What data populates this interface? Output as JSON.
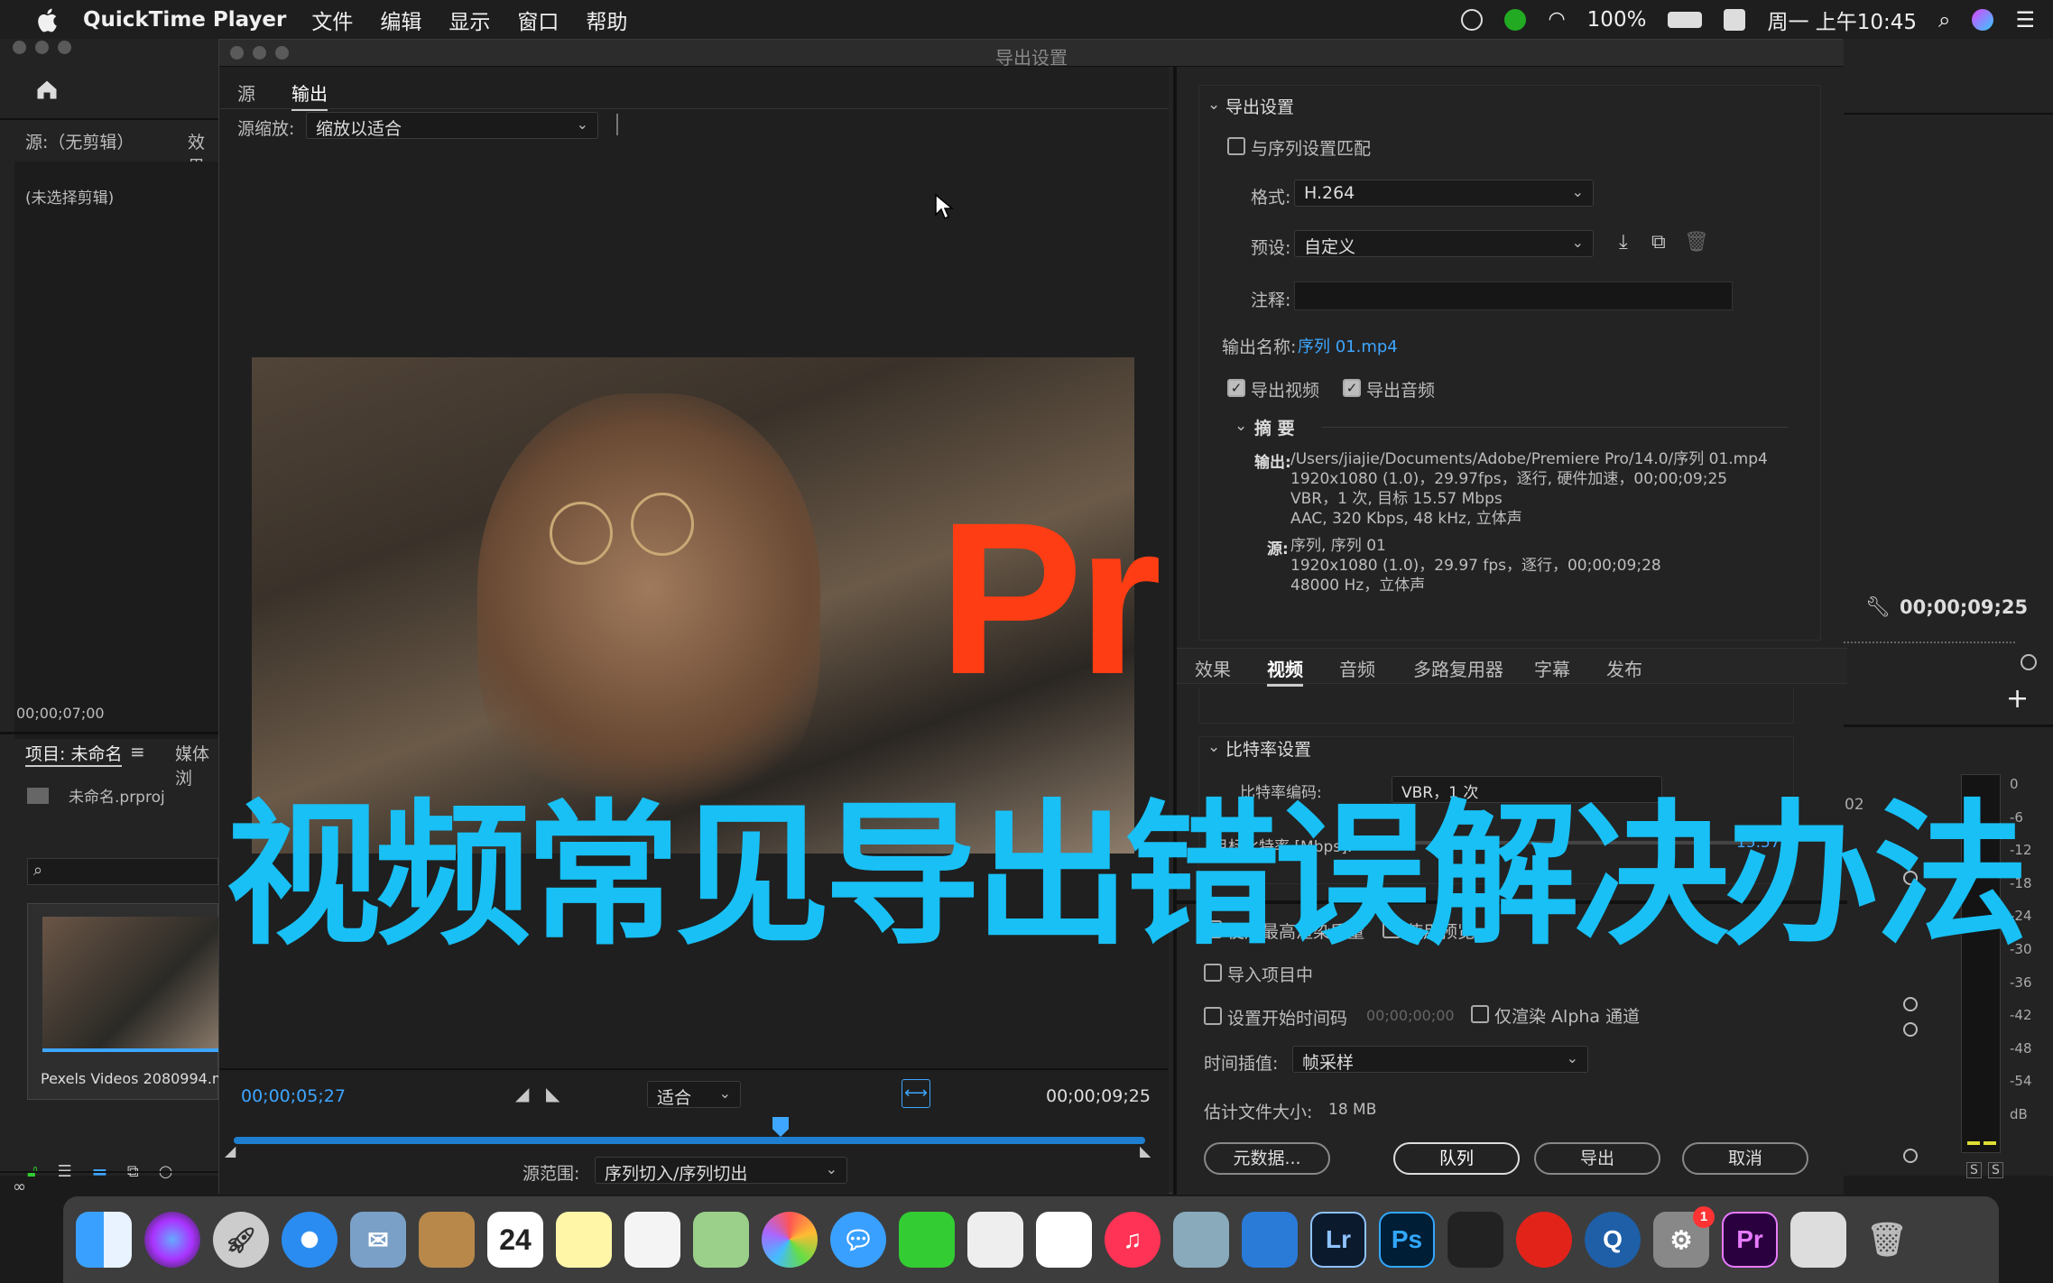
{
  "menubar": {
    "app_name": "QuickTime Player",
    "menus": [
      "文件",
      "编辑",
      "显示",
      "窗口",
      "帮助"
    ],
    "battery": "100%",
    "datetime": "周一 上午10:45"
  },
  "bg_left": {
    "source_label": "源:（无剪辑）",
    "effects_tab": "效果",
    "no_clip": "(未选择剪辑)",
    "timecode": "00;00;07;00",
    "project_tab": "项目: 未命名",
    "media_tab": "媒体浏",
    "project_file": "未命名.prproj",
    "thumb_caption": "Pexels Videos 2080994.m"
  },
  "bg_right": {
    "timecode": "00;00;09;25",
    "meter_labels": [
      "0",
      "-6",
      "-12",
      "-18",
      "-24",
      "-30",
      "-36",
      "-42",
      "-48",
      "-54",
      "dB"
    ],
    "solo": [
      "S",
      "S"
    ]
  },
  "dialog": {
    "title": "导出设置",
    "tabs": {
      "source": "源",
      "output": "输出"
    },
    "source_scale_label": "源缩放:",
    "source_scale_value": "缩放以适合",
    "playback": {
      "current_tc": "00;00;05;27",
      "fit_value": "适合",
      "end_tc": "00;00;09;25",
      "range_label": "源范围:",
      "range_value": "序列切入/序列切出",
      "playhead_fraction": 0.6
    },
    "export_settings": {
      "header": "导出设置",
      "match_sequence": "与序列设置匹配",
      "format_label": "格式:",
      "format_value": "H.264",
      "preset_label": "预设:",
      "preset_value": "自定义",
      "comment_label": "注释:",
      "output_name_label": "输出名称:",
      "output_name_value": "序列 01.mp4",
      "export_video": "导出视频",
      "export_audio": "导出音频",
      "summary_header": "摘 要",
      "output_label": "输出:",
      "output_lines": [
        "/Users/jiajie/Documents/Adobe/Premiere Pro/14.0/序列 01.mp4",
        "1920x1080 (1.0)，29.97fps，逐行, 硬件加速，00;00;09;25",
        "VBR，1 次, 目标 15.57 Mbps",
        "AAC, 320 Kbps, 48  kHz, 立体声"
      ],
      "source_label": "源:",
      "source_lines": [
        "序列, 序列 01",
        "1920x1080 (1.0)，29.97 fps，逐行，00;00;09;28",
        "48000 Hz，立体声"
      ]
    },
    "settings_tabs": [
      "效果",
      "视频",
      "音频",
      "多路复用器",
      "字幕",
      "发布"
    ],
    "active_settings_tab": "视频",
    "bitrate": {
      "header": "比特率设置",
      "encoding_label": "比特率编码:",
      "encoding_value": "VBR，1 次",
      "target_label": "目标比特率 [Mbps]:",
      "target_value": "15.57",
      "side_value": "02"
    },
    "options": {
      "max_render": "使用最高渲染质量",
      "use_previews": "使用预览",
      "import_project": "导入项目中",
      "set_start_tc": "设置开始时间码",
      "start_tc_value": "00;00;00;00",
      "alpha_only": "仅渲染 Alpha 通道",
      "time_interp_label": "时间插值:",
      "time_interp_value": "帧采样",
      "est_size_label": "估计文件大小:",
      "est_size_value": "18 MB"
    },
    "buttons": {
      "metadata": "元数据...",
      "queue": "队列",
      "export": "导出",
      "cancel": "取消"
    }
  },
  "overlay": {
    "logo": "Pr",
    "title": "视频常见导出错误解决办法"
  },
  "dock": {
    "calendar_day": "24",
    "lr": "Lr",
    "ps": "Ps",
    "pr": "Pr",
    "badge": "1"
  },
  "colors": {
    "accent_blue": "#3ea6ff",
    "pr_orange": "#ff3d14",
    "title_cyan": "#18c0f5"
  }
}
